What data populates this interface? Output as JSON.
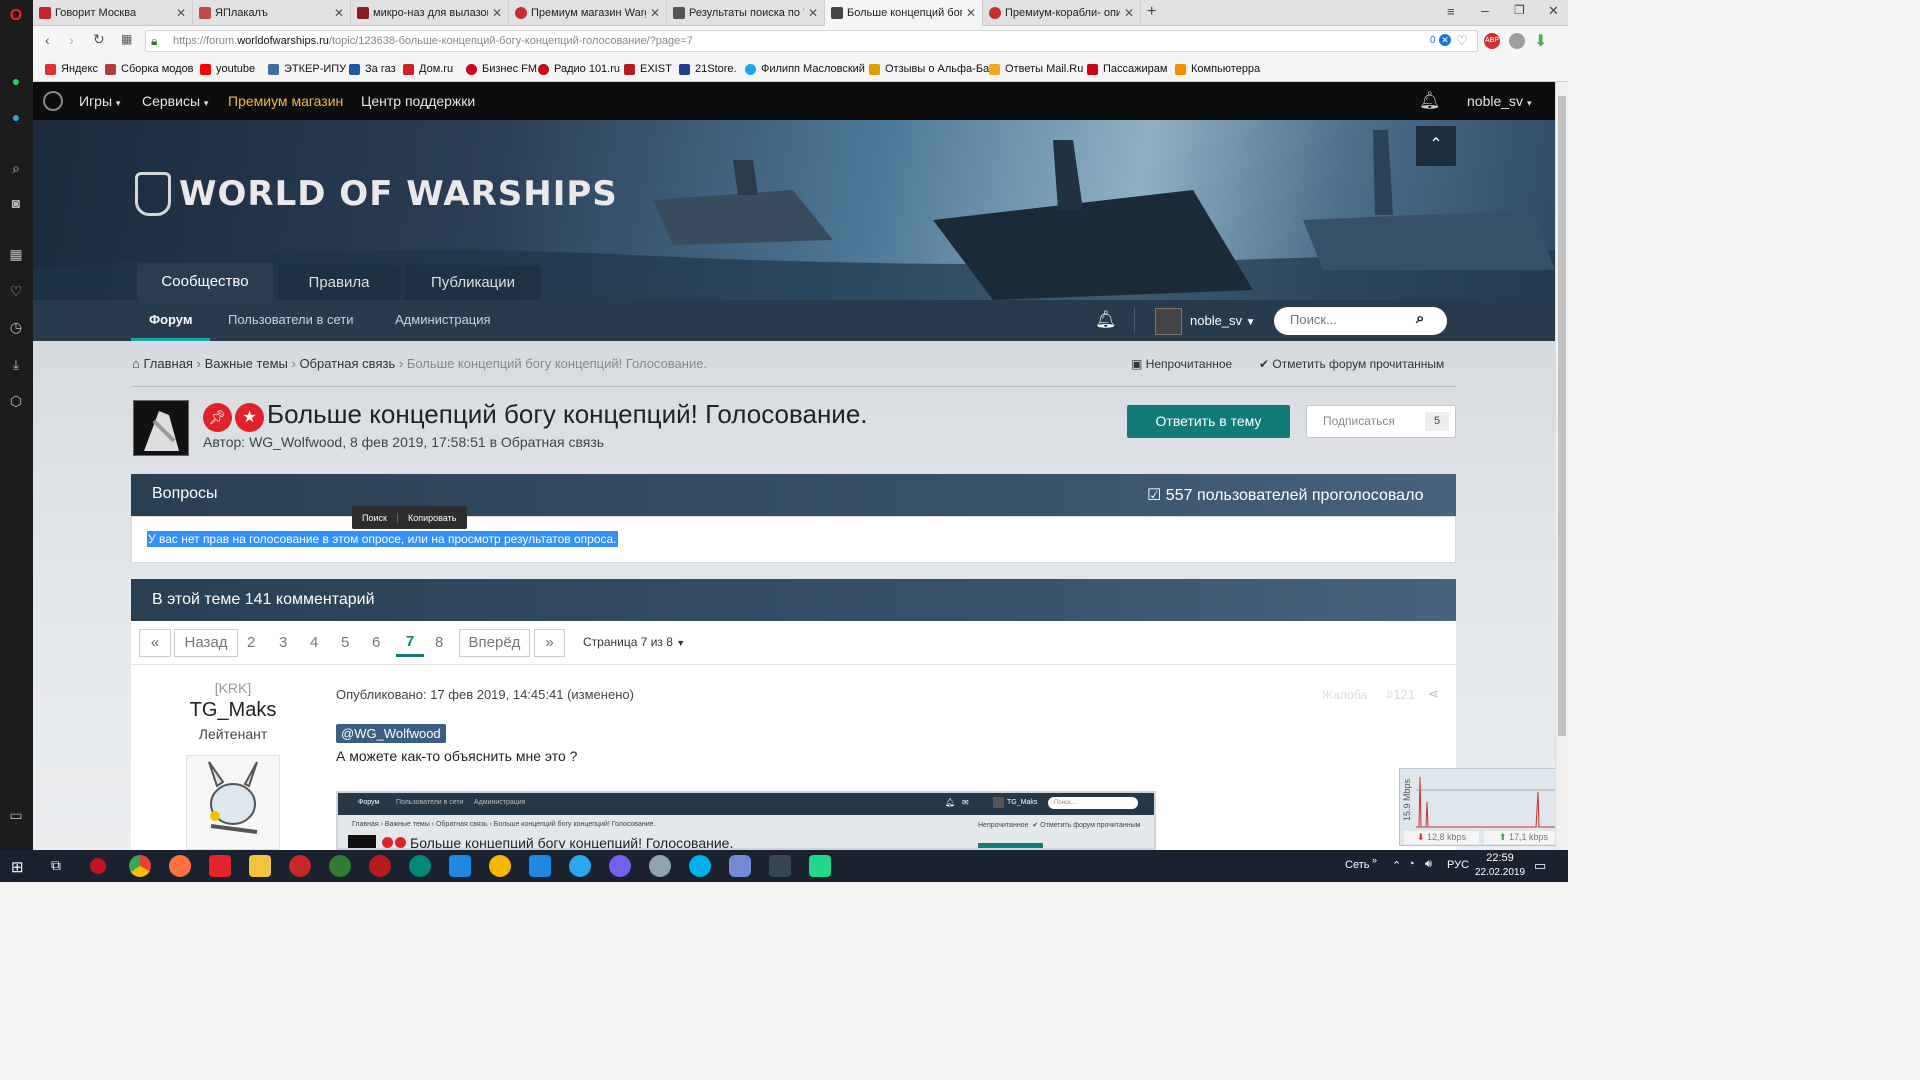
{
  "browser": {
    "tabs": [
      {
        "title": "Говорит Москва",
        "color": "#c4262e"
      },
      {
        "title": "ЯПлакалъ",
        "color": "#c04848"
      },
      {
        "title": "микро-наз для вылазок",
        "color": "#8b1d1d"
      },
      {
        "title": "Премиум магазин Warga",
        "color": "#c83030"
      },
      {
        "title": "Результаты поиска по \"пр",
        "color": "#555555"
      },
      {
        "title": "Больше концепций богу",
        "color": "#444444"
      },
      {
        "title": "Премиум-корабли- опис",
        "color": "#c83030"
      }
    ],
    "url_prefix": "https://forum.",
    "url_host": "worldofwarships.ru",
    "url_path": "/topic/123638-больше-концепций-богу-концепций-голосование/?page=7",
    "url_counter": "0",
    "bookmarks": [
      {
        "label": "Яндекс",
        "color": "#e62d2d"
      },
      {
        "label": "Сборка модов",
        "color": "#b23b3b"
      },
      {
        "label": "youtube",
        "color": "#ff0000"
      },
      {
        "label": "ЭТКЕР-ИПУ",
        "color": "#3a6ea5"
      },
      {
        "label": "За газ",
        "color": "#1e56a0"
      },
      {
        "label": "Дом.ru",
        "color": "#d11f26"
      },
      {
        "label": "Бизнес FM",
        "color": "#d0021b"
      },
      {
        "label": "Радио 101.ru",
        "color": "#d0021b"
      },
      {
        "label": "EXIST",
        "color": "#b71c1c"
      },
      {
        "label": "21Store.",
        "color": "#1b3f8b"
      },
      {
        "label": "Филипп Масловский",
        "color": "#1da1f2"
      },
      {
        "label": "Отзывы о Альфа-Ба",
        "color": "#e0a000"
      },
      {
        "label": "Ответы Mail.Ru",
        "color": "#f5a623"
      },
      {
        "label": "Пассажирам",
        "color": "#d0021b"
      },
      {
        "label": "Компьютерра",
        "color": "#f29000"
      }
    ]
  },
  "site": {
    "nav": {
      "games": "Игры",
      "services": "Сервисы",
      "premium": "Премиум магазин",
      "support": "Центр поддержки",
      "user": "noble_sv"
    },
    "logo": "WORLD OF WARSHIPS",
    "hero_tabs": [
      "Сообщество",
      "Правила",
      "Публикации"
    ],
    "subnav": {
      "forum": "Форум",
      "online": "Пользователи в сети",
      "admin": "Администрация",
      "user": "noble_sv",
      "search_placeholder": "Поиск..."
    },
    "breadcrumb": {
      "home": "Главная",
      "important": "Важные темы",
      "feedback": "Обратная связь",
      "current": "Больше концепций богу концепций! Голосование."
    },
    "breadcrumb_actions": {
      "unread": "Непрочитанное",
      "mark_read": "Отметить форум прочитанным"
    },
    "topic": {
      "title": "Больше концепций богу концепций! Голосование.",
      "meta_prefix": "Автор:",
      "author": "WG_Wolfwood",
      "date": "8 фев 2019, 17:58:51",
      "in_word": "в",
      "forum": "Обратная связь",
      "reply_button": "Ответить в тему",
      "subscribe_button": "Подписаться",
      "subscribe_count": "5"
    },
    "poll": {
      "header": "Вопросы",
      "votes": "557 пользователей проголосовало",
      "notice": "У вас нет прав на голосование в этом опросе, или на просмотр результатов опроса.",
      "popup": [
        "Поиск",
        "Копировать"
      ]
    },
    "comments": {
      "header": "В этой теме 141 комментарий",
      "pagination": {
        "first": "«",
        "prev": "Назад",
        "pages": [
          "2",
          "3",
          "4",
          "5",
          "6",
          "7",
          "8"
        ],
        "current": "7",
        "next": "Вперёд",
        "last": "»",
        "page_label": "Страница 7 из 8"
      }
    },
    "post": {
      "clan": "[KRK]",
      "username": "TG_Maks",
      "rank": "Лейтенант",
      "published": "Опубликовано: 17 фев 2019, 14:45:41 (изменено)",
      "report": "Жалоба",
      "number": "#121",
      "mention": "@WG_Wolfwood",
      "text": "А можете как-то объяснить мне это ?",
      "embedded": {
        "nav": [
          "Форум",
          "Пользователи в сети",
          "Администрация"
        ],
        "user": "TG_Maks",
        "search": "Поиск...",
        "breadcrumb": [
          "Главная",
          "Важные темы",
          "Обратная связь",
          "Больше концепций богу концепций! Голосование."
        ],
        "actions": [
          "Непрочитанное",
          "Отметить форум прочитанным"
        ],
        "title": "Больше концепций богу концепций! Голосование."
      }
    }
  },
  "net_monitor": {
    "label": "15.9 Mbps",
    "down": "12,8 kbps",
    "up": "17,1 kbps"
  },
  "taskbar": {
    "network": "Сеть",
    "lang": "РУС",
    "time": "22:59",
    "date": "22.02.2019"
  }
}
